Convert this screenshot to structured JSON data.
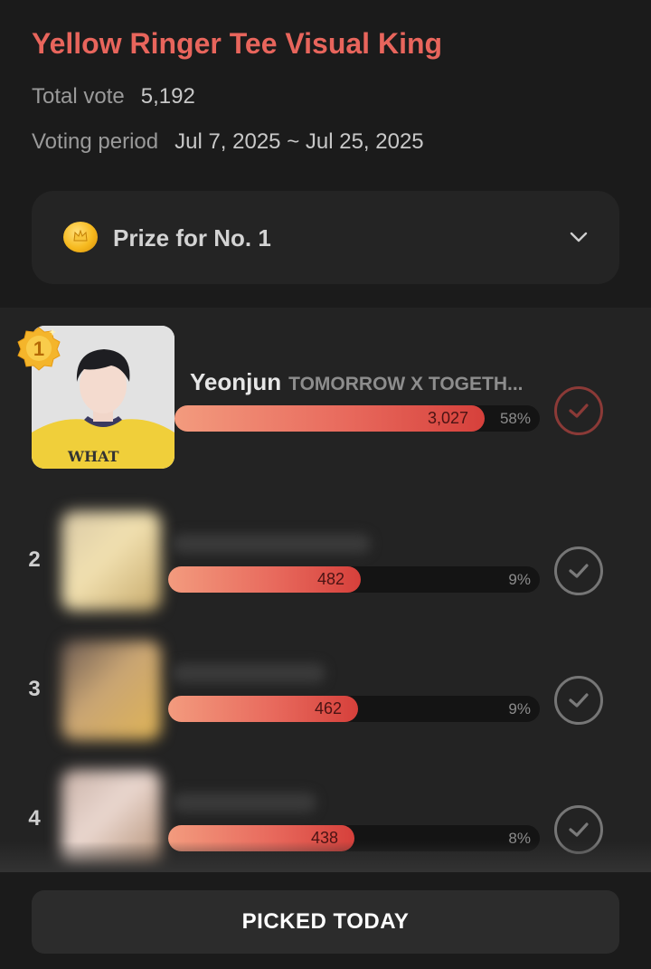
{
  "event": {
    "title": "Yellow Ringer Tee Visual King",
    "total_vote_label": "Total vote",
    "total_vote_value": "5,192",
    "voting_period_label": "Voting period",
    "voting_period_value": "Jul 7, 2025 ~ Jul 25, 2025"
  },
  "prize": {
    "label": "Prize for No. 1",
    "icon": "coin-icon",
    "toggle_icon": "chevron-down-icon"
  },
  "rankings": [
    {
      "rank": "1",
      "name": "Yeonjun",
      "group": "TOMORROW X TOGETH...",
      "votes": "3,027",
      "percent": "58%",
      "fill": 0.58,
      "selected": true
    },
    {
      "rank": "2",
      "votes": "482",
      "percent": "9%",
      "fill": 0.09,
      "selected": false
    },
    {
      "rank": "3",
      "votes": "462",
      "percent": "9%",
      "fill": 0.09,
      "selected": false
    },
    {
      "rank": "4",
      "votes": "438",
      "percent": "8%",
      "fill": 0.08,
      "selected": false
    }
  ],
  "footer": {
    "button_label": "PICKED TODAY"
  },
  "colors": {
    "accent": "#e8655c",
    "bar_start": "#f39b7e",
    "bar_end": "#d6403b",
    "background": "#1b1b1b",
    "list_background": "#232323"
  }
}
